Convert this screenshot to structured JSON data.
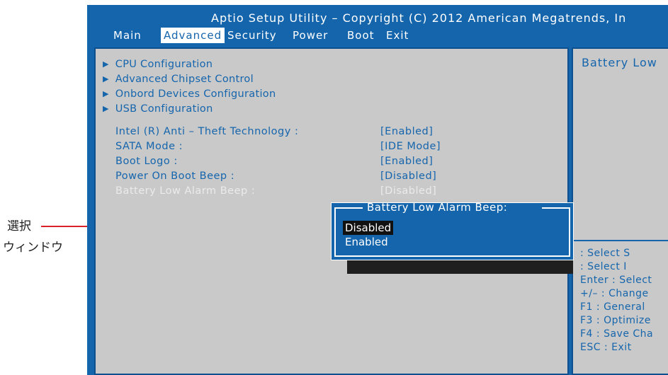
{
  "annotation": {
    "line1": "選択",
    "line2": "ウィンドウ",
    "color": "#d8222a"
  },
  "bios": {
    "title": "Aptio Setup Utility – Copyright (C) 2012 American Megatrends, In",
    "menu": [
      {
        "label": "Main",
        "active": false
      },
      {
        "label": "Advanced",
        "active": true
      },
      {
        "label": "Security",
        "active": false
      },
      {
        "label": "Power",
        "active": false
      },
      {
        "label": "Boot",
        "active": false
      },
      {
        "label": "Exit",
        "active": false
      }
    ],
    "submenus": [
      "CPU Configuration",
      "Advanced Chipset Control",
      "Onbord Devices Configuration",
      "USB Configuration"
    ],
    "settings": [
      {
        "label": "Intel (R) Anti – Theft Technology :",
        "value": "[Enabled]",
        "dim": false
      },
      {
        "label": "SATA Mode :",
        "value": "[IDE Mode]",
        "dim": false
      },
      {
        "label": "Boot Logo :",
        "value": "[Enabled]",
        "dim": false
      },
      {
        "label": "Power On Boot Beep :",
        "value": "[Disabled]",
        "dim": false
      },
      {
        "label": "Battery Low Alarm Beep :",
        "value": "[Disabled]",
        "dim": true
      }
    ],
    "help": {
      "title": "Battery Low",
      "keys": [
        ": Select S",
        ": Select I",
        "Enter : Select",
        "+/– : Change",
        "F1 : General",
        "F3 : Optimize",
        "F4 : Save Cha",
        "ESC : Exit"
      ]
    },
    "popup": {
      "title": "Battery Low Alarm Beep:",
      "options": [
        {
          "label": "Disabled",
          "selected": true
        },
        {
          "label": "Enabled",
          "selected": false
        }
      ]
    },
    "colors": {
      "blue": "#1565ad",
      "panel": "#c9c9c9"
    }
  }
}
